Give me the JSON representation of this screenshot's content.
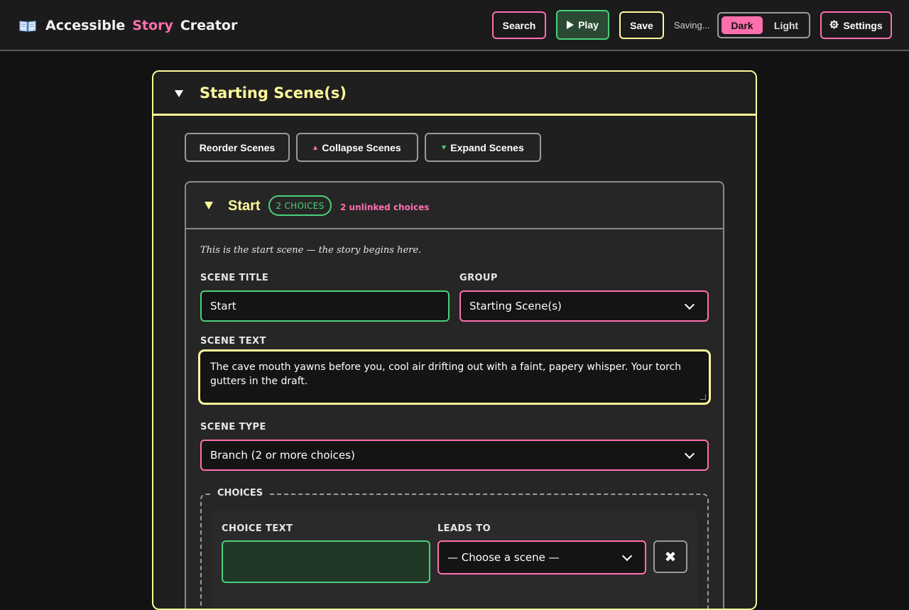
{
  "header": {
    "title_part1": "Accessible",
    "title_part2": "Story",
    "title_part3": "Creator",
    "icon": "open-book-icon",
    "search_label": "Search",
    "play_label": "Play",
    "save_label": "Save",
    "status_text": "Saving...",
    "theme": {
      "dark_label": "Dark",
      "light_label": "Light",
      "selected": "Dark"
    },
    "settings_label": "Settings"
  },
  "group": {
    "title": "Starting Scene(s)",
    "toolbar": {
      "reorder_label": "Reorder Scenes",
      "collapse_label": "Collapse Scenes",
      "expand_label": "Expand Scenes"
    }
  },
  "scene": {
    "name": "Start",
    "choices_badge": "2 CHOICES",
    "unlinked_text": "2 unlinked choices",
    "note": "This is the start scene — the story begins here.",
    "title_label": "SCENE TITLE",
    "title_value": "Start",
    "group_label": "GROUP",
    "group_value": "Starting Scene(s)",
    "text_label": "SCENE TEXT",
    "text_value": "The cave mouth yawns before you, cool air drifting out with a faint, papery whisper. Your torch gutters in the draft.",
    "type_label": "SCENE TYPE",
    "type_value": "Branch (2 or more choices)",
    "choices_legend": "CHOICES",
    "choice": {
      "text_label": "CHOICE TEXT",
      "text_value": "",
      "leads_label": "LEADS TO",
      "leads_value": "— Choose a scene —",
      "remove_symbol": "✖"
    }
  },
  "colors": {
    "accent_pink": "#ff6fae",
    "accent_green": "#49d07c",
    "accent_yellow": "#fffa9c",
    "background": "#121212"
  }
}
